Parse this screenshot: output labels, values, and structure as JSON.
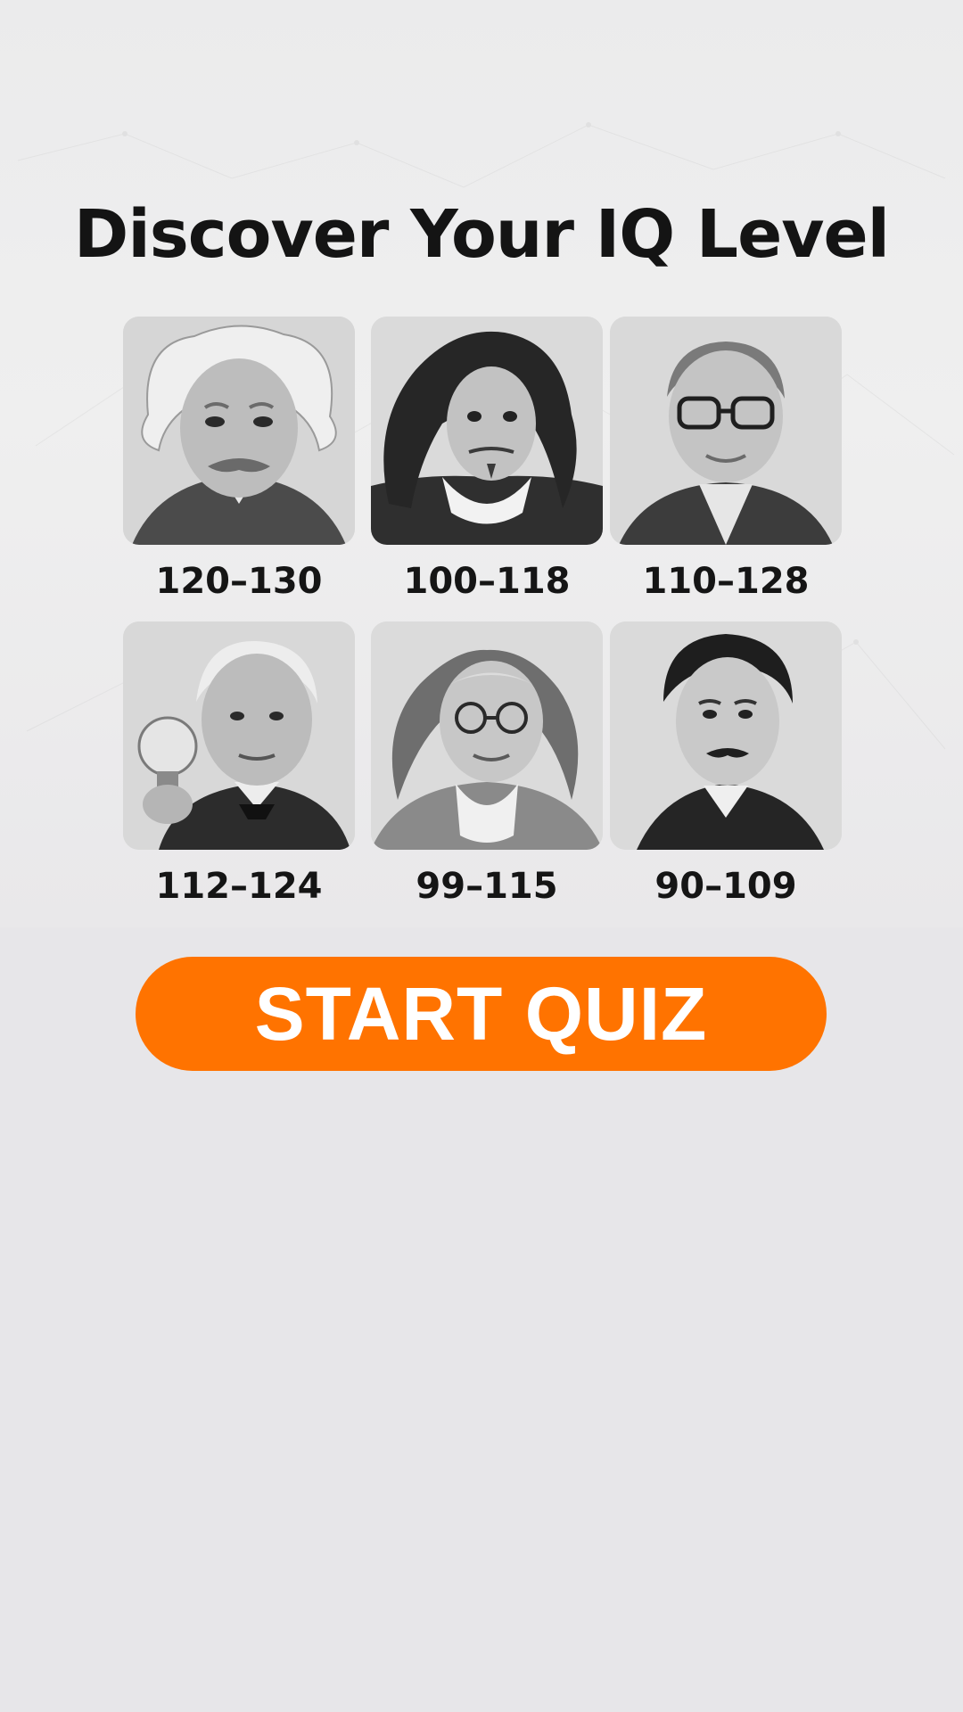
{
  "title": "Discover Your IQ Level",
  "cards": [
    {
      "range": "120–130",
      "portrait_icon": "portrait-wild-white-hair-icon"
    },
    {
      "range": "100–118",
      "portrait_icon": "portrait-long-dark-hair-icon"
    },
    {
      "range": "110–128",
      "portrait_icon": "portrait-glasses-icon"
    },
    {
      "range": "112–124",
      "portrait_icon": "portrait-lightbulb-icon"
    },
    {
      "range": "99–115",
      "portrait_icon": "portrait-round-spectacles-icon"
    },
    {
      "range": "90–109",
      "portrait_icon": "portrait-mustache-icon"
    }
  ],
  "start_button": {
    "label": "START QUIZ"
  },
  "colors": {
    "accent": "#ff7300",
    "background": "#e7e6e9",
    "text": "#141414"
  }
}
